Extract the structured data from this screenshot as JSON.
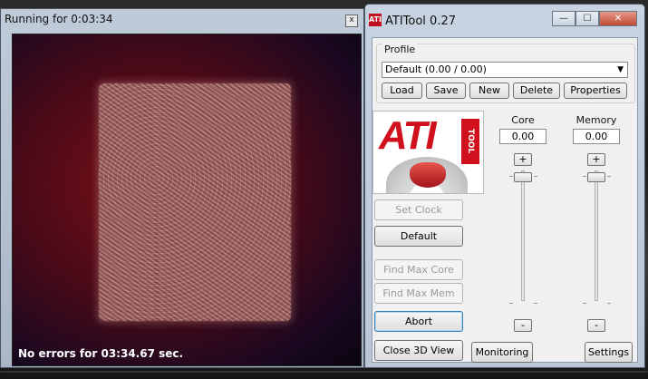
{
  "view_window": {
    "title": "Running for 0:03:34",
    "close_label": "x",
    "status": "No errors for 03:34.67 sec."
  },
  "ati_window": {
    "title": "ATITool 0.27",
    "icon_text": "ATI",
    "caption": {
      "minimize": "—",
      "maximize": "☐",
      "close": "✕"
    },
    "profile": {
      "group_label": "Profile",
      "selected": "Default (0.00 / 0.00)",
      "buttons": {
        "load": "Load",
        "save": "Save",
        "new": "New",
        "delete": "Delete",
        "properties": "Properties"
      }
    },
    "logo": {
      "text": "ATI",
      "tool_text": "TOOL"
    },
    "core": {
      "label": "Core",
      "value": "0.00",
      "plus": "+",
      "minus": "-"
    },
    "memory": {
      "label": "Memory",
      "value": "0.00",
      "plus": "+",
      "minus": "-"
    },
    "buttons": {
      "set_clock": "Set Clock",
      "default": "Default",
      "find_max_core": "Find Max Core",
      "find_max_mem": "Find Max Mem",
      "abort": "Abort",
      "close_3d_view": "Close 3D View",
      "monitoring": "Monitoring",
      "settings": "Settings"
    }
  }
}
